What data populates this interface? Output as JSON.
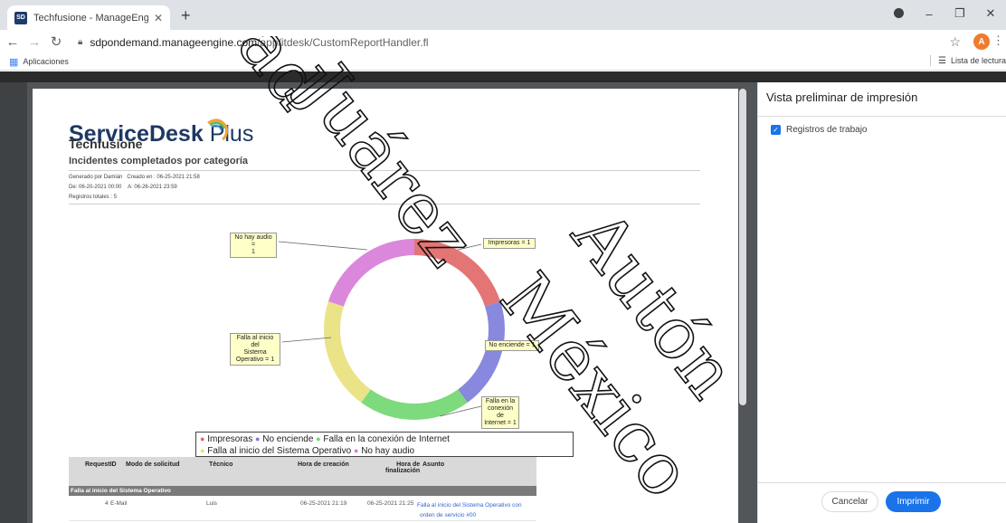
{
  "browser": {
    "tab_title": "Techfusione - ManageEngine Se",
    "url_host": "sdpondemand.manageengine.com",
    "url_path": "/app/itdesk/CustomReportHandler.fl",
    "bookmarks_label": "Aplicaciones",
    "reading_list": "Lista de lectura",
    "profile_initial": "A"
  },
  "report": {
    "logo_main": "ServiceDesk",
    "logo_plus": "Plus",
    "organization": "Techfusione",
    "title": "Incidentes completados por categoría",
    "generated_by": "Generado por Damián",
    "created_on": "Creado en : 06-25-2021 21:58",
    "from": "De: 06-20-2021 00:00",
    "to": "A: 06-26-2021 23:59",
    "total_records": "Registros totales : 5"
  },
  "chart_data": {
    "type": "pie",
    "style": "donut",
    "categories": [
      "Impresoras",
      "No enciende",
      "Falla en la conexión de Internet",
      "Falla al inicio del Sistema Operativo",
      "No hay audio"
    ],
    "values": [
      1,
      1,
      1,
      1,
      1
    ],
    "colors": [
      "#e06666",
      "#7b7bdb",
      "#6fd66f",
      "#e8e07a",
      "#d77ad7"
    ],
    "callouts": [
      {
        "key": "impresoras",
        "text": "Impresoras = 1"
      },
      {
        "key": "no_enciende",
        "text": "No enciende = 1"
      },
      {
        "key": "internet",
        "lines": [
          "Falla en la",
          "conexión de",
          "Internet = 1"
        ]
      },
      {
        "key": "so",
        "lines": [
          "Falla al inicio del",
          "Sistema",
          "Operativo = 1"
        ]
      },
      {
        "key": "audio",
        "lines": [
          "No hay audio =",
          "1"
        ]
      }
    ],
    "legend": {
      "line1": [
        "Impresoras",
        "No enciende",
        "Falla en la conexión de Internet"
      ],
      "line2": [
        "Falla al inicio del Sistema Operativo",
        "No hay audio"
      ]
    }
  },
  "table": {
    "headers": {
      "request_id": "RequestID",
      "mode": "Modo de solicitud",
      "tech": "Técnico",
      "created": "Hora de creación",
      "finished_1": "Hora de",
      "finished_2": "finalización",
      "subject": "Asunto"
    },
    "group": "Falla al inicio del Sistema Operativo",
    "rows": [
      {
        "id": "4",
        "mode": "E-Mail",
        "tech": "Luis",
        "created": "06-25-2021 21:19",
        "finished": "06-25-2021 21:25",
        "subject_1": "Falla al inicio del Sistema Operativo con",
        "subject_2": "orden de servicio #00"
      }
    ]
  },
  "dialog": {
    "title": "Vista preliminar de impresión",
    "option_label": "Registros de trabajo",
    "cancel": "Cancelar",
    "print": "Imprimir"
  },
  "watermark": {
    "text_1": "Juárez",
    "text_2": "México",
    "text_3": "Autón",
    "text_4": "ad"
  }
}
